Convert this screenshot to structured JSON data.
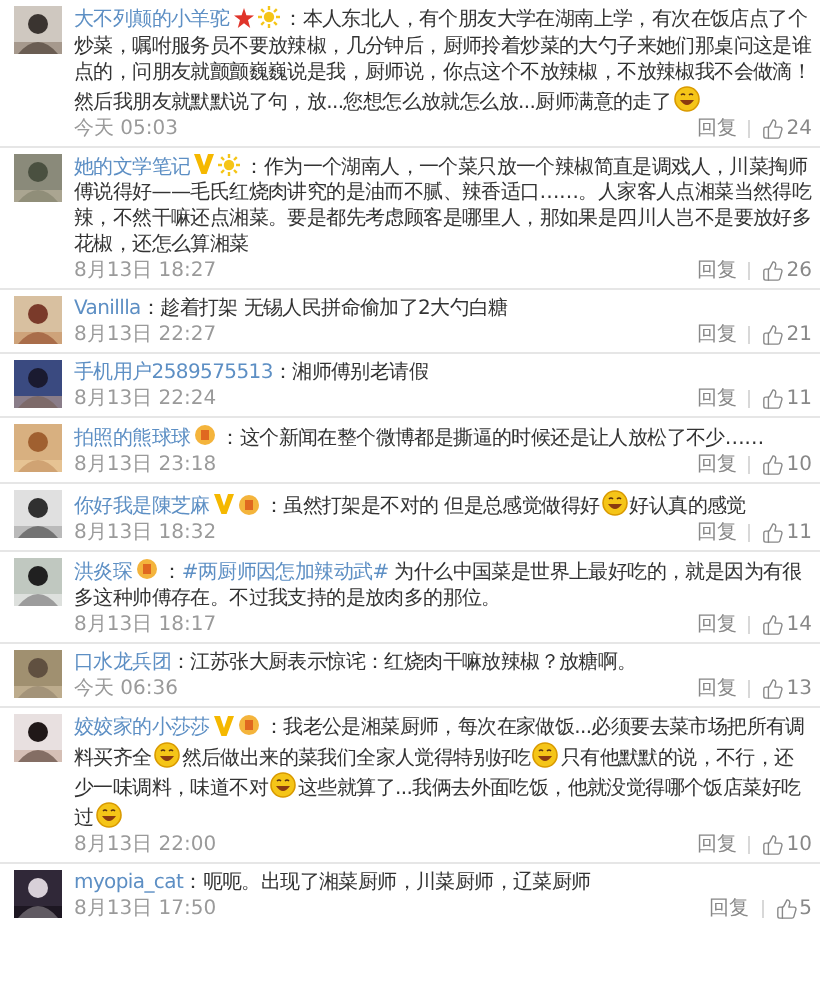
{
  "comments": [
    {
      "user": "大不列颠的小羊驼",
      "badges": [
        {
          "kind": "star"
        },
        {
          "kind": "sun"
        }
      ],
      "parts": [
        {
          "kind": "text",
          "text": "：本人东北人，有个朋友大学在湖南上学，有次在饭店点了个炒菜，嘱咐服务员不要放辣椒，几分钟后，厨师拎着炒菜的大勺子来她们那桌问这是谁点的，问朋友就颤颤巍巍说是我，厨师说，你点这个不放辣椒，不放辣椒我不会做滴！然后我朋友就默默说了句，放...您想怎么放就怎么放...厨师满意的走了"
        },
        {
          "kind": "emoji"
        }
      ],
      "time": "今天 05:03",
      "reply": "回复",
      "likes": "24"
    },
    {
      "user": "她的文学笔记",
      "badges": [
        {
          "kind": "v"
        },
        {
          "kind": "sun"
        }
      ],
      "parts": [
        {
          "kind": "text",
          "text": "：作为一个湖南人，一个菜只放一个辣椒简直是调戏人，川菜掏师傅说得好——毛氏红烧肉讲究的是油而不腻、辣香适口……。人家客人点湘菜当然得吃辣，不然干嘛还点湘菜。要是都先考虑顾客是哪里人，那如果是四川人岂不是要放好多花椒，还怎么算湘菜"
        }
      ],
      "time": "8月13日 18:27",
      "reply": "回复",
      "likes": "26"
    },
    {
      "user": "Vanillla",
      "parts": [
        {
          "kind": "text",
          "text": "：趁着打架 无锡人民拼命偷加了2大勺白糖"
        }
      ],
      "time": "8月13日 22:27",
      "reply": "回复",
      "likes": "21"
    },
    {
      "user": "手机用户2589575513",
      "parts": [
        {
          "kind": "text",
          "text": "：湘师傅别老请假"
        }
      ],
      "time": "8月13日 22:24",
      "reply": "回复",
      "likes": "11"
    },
    {
      "user": "拍照的熊球球",
      "badges": [
        {
          "kind": "medal"
        }
      ],
      "parts": [
        {
          "kind": "text",
          "text": "：这个新闻在整个微博都是撕逼的时候还是让人放松了不少……"
        }
      ],
      "time": "8月13日 23:18",
      "reply": "回复",
      "likes": "10"
    },
    {
      "user": "你好我是陳芝麻",
      "badges": [
        {
          "kind": "v"
        },
        {
          "kind": "medal"
        }
      ],
      "parts": [
        {
          "kind": "text",
          "text": "：虽然打架是不对的 但是总感觉做得好"
        },
        {
          "kind": "emoji"
        },
        {
          "kind": "text",
          "text": "好认真的感觉"
        }
      ],
      "time": "8月13日 18:32",
      "reply": "回复",
      "likes": "11"
    },
    {
      "user": "洪炎琛",
      "badges": [
        {
          "kind": "medal"
        }
      ],
      "parts": [
        {
          "kind": "text",
          "text": "："
        },
        {
          "kind": "link",
          "text": "#两厨师因怎加辣动武#"
        },
        {
          "kind": "text",
          "text": " 为什么中国菜是世界上最好吃的，就是因为有很多这种帅傅存在。不过我支持的是放肉多的那位。"
        }
      ],
      "time": "8月13日 18:17",
      "reply": "回复",
      "likes": "14"
    },
    {
      "user": "口水龙兵团",
      "parts": [
        {
          "kind": "text",
          "text": "：江苏张大厨表示惊诧：红烧肉干嘛放辣椒？放糖啊。"
        }
      ],
      "time": "今天 06:36",
      "reply": "回复",
      "likes": "13"
    },
    {
      "user": "姣姣家的小莎莎",
      "badges": [
        {
          "kind": "v"
        },
        {
          "kind": "medal"
        }
      ],
      "parts": [
        {
          "kind": "text",
          "text": "：我老公是湘菜厨师，每次在家做饭...必须要去菜市场把所有调料买齐全"
        },
        {
          "kind": "emoji"
        },
        {
          "kind": "text",
          "text": "然后做出来的菜我们全家人觉得特别好吃"
        },
        {
          "kind": "emoji"
        },
        {
          "kind": "text",
          "text": "只有他默默的说，不行，还少一味调料，味道不对"
        },
        {
          "kind": "emoji"
        },
        {
          "kind": "text",
          "text": "这些就算了...我俩去外面吃饭，他就没觉得哪个饭店菜好吃过"
        },
        {
          "kind": "emoji"
        }
      ],
      "time": "8月13日 22:00",
      "reply": "回复",
      "likes": "10"
    },
    {
      "user": "myopia_cat",
      "parts": [
        {
          "kind": "text",
          "text": "：呃呃。出现了湘菜厨师，川菜厨师，辽菜厨师"
        }
      ],
      "time": "8月13日 17:50",
      "reply": "回复",
      "likes": "5"
    }
  ]
}
